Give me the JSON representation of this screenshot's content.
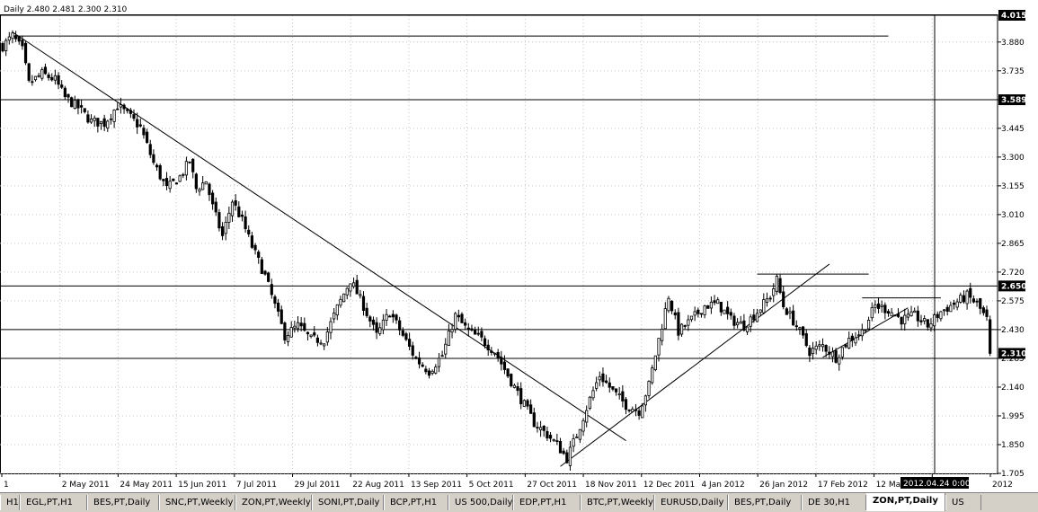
{
  "header": {
    "text": "Daily  2.480 2.481 2.300 2.310"
  },
  "tabs": [
    "H1",
    "EGL,PT,H1",
    "BES,PT,Daily",
    "SNC,PT,Weekly",
    "ZON,PT,Weekly",
    "SONI,PT,Daily",
    "BCP,PT,H1",
    "US 500,Daily",
    "EDP,PT,H1",
    "BTC,PT,Weekly",
    "EURUSD,Daily",
    "BES,PT,Daily",
    "DE 30,H1",
    "ZON,PT,Daily",
    "US"
  ],
  "active_tab_index": 13,
  "colors": {
    "background": "#ffffff",
    "candle": "#000000",
    "grid": "#c0c0c0",
    "label_bg": "#000000",
    "label_text": "#ffffff",
    "tab_bar": "#d4d0c8"
  },
  "crosshair": {
    "time_label": "2012.04.24 0:00",
    "price_label": "4.015"
  },
  "chart_data": {
    "type": "candlestick",
    "title": "",
    "symbol_ohlc": {
      "open": 2.48,
      "high": 2.481,
      "low": 2.3,
      "close": 2.31
    },
    "y_ticks": [
      3.88,
      3.735,
      3.589,
      3.445,
      3.3,
      3.155,
      3.01,
      2.865,
      2.72,
      2.575,
      2.43,
      2.285,
      2.14,
      1.995,
      1.85,
      1.705
    ],
    "ylim": [
      1.705,
      4.015
    ],
    "x_ticks": [
      "1",
      "2 May 2011",
      "24 May 2011",
      "15 Jun 2011",
      "7 Jul 2011",
      "29 Jul 2011",
      "22 Aug 2011",
      "13 Sep 2011",
      "5 Oct 2011",
      "27 Oct 2011",
      "18 Nov 2011",
      "12 Dec 2011",
      "4 Jan 2012",
      "26 Jan 2012",
      "17 Feb 2012",
      "12 Mar 2012",
      "3 A",
      "2012"
    ],
    "price_labels": [
      4.015,
      3.589,
      2.65,
      2.31
    ],
    "horizontal_levels": [
      4.015,
      3.589,
      2.65,
      2.43,
      2.285
    ],
    "close_path": [
      [
        0,
        3.86
      ],
      [
        3,
        3.91
      ],
      [
        6,
        3.84
      ],
      [
        8,
        3.67
      ],
      [
        12,
        3.72
      ],
      [
        16,
        3.69
      ],
      [
        19,
        3.6
      ],
      [
        23,
        3.55
      ],
      [
        27,
        3.48
      ],
      [
        31,
        3.47
      ],
      [
        35,
        3.56
      ],
      [
        39,
        3.5
      ],
      [
        42,
        3.45
      ],
      [
        46,
        3.27
      ],
      [
        50,
        3.14
      ],
      [
        54,
        3.2
      ],
      [
        57,
        3.28
      ],
      [
        59,
        3.14
      ],
      [
        62,
        3.18
      ],
      [
        64,
        3.05
      ],
      [
        67,
        2.9
      ],
      [
        70,
        3.08
      ],
      [
        73,
        2.98
      ],
      [
        76,
        2.85
      ],
      [
        80,
        2.7
      ],
      [
        83,
        2.55
      ],
      [
        86,
        2.4
      ],
      [
        90,
        2.45
      ],
      [
        94,
        2.38
      ],
      [
        98,
        2.38
      ],
      [
        102,
        2.54
      ],
      [
        106,
        2.68
      ],
      [
        110,
        2.55
      ],
      [
        114,
        2.4
      ],
      [
        118,
        2.52
      ],
      [
        122,
        2.4
      ],
      [
        126,
        2.28
      ],
      [
        130,
        2.22
      ],
      [
        134,
        2.3
      ],
      [
        138,
        2.5
      ],
      [
        142,
        2.42
      ],
      [
        146,
        2.38
      ],
      [
        150,
        2.32
      ],
      [
        154,
        2.2
      ],
      [
        158,
        2.08
      ],
      [
        162,
        1.96
      ],
      [
        166,
        1.9
      ],
      [
        169,
        1.85
      ],
      [
        172,
        1.78
      ],
      [
        175,
        1.9
      ],
      [
        179,
        2.08
      ],
      [
        182,
        2.2
      ],
      [
        186,
        2.12
      ],
      [
        190,
        2.05
      ],
      [
        194,
        2.02
      ],
      [
        197,
        2.15
      ],
      [
        200,
        2.38
      ],
      [
        203,
        2.6
      ],
      [
        206,
        2.42
      ],
      [
        210,
        2.48
      ],
      [
        214,
        2.55
      ],
      [
        218,
        2.56
      ],
      [
        222,
        2.48
      ],
      [
        226,
        2.45
      ],
      [
        230,
        2.52
      ],
      [
        234,
        2.6
      ],
      [
        236,
        2.68
      ],
      [
        238,
        2.55
      ],
      [
        242,
        2.45
      ],
      [
        246,
        2.32
      ],
      [
        250,
        2.35
      ],
      [
        254,
        2.29
      ],
      [
        258,
        2.38
      ],
      [
        262,
        2.42
      ],
      [
        266,
        2.55
      ],
      [
        270,
        2.53
      ],
      [
        274,
        2.48
      ],
      [
        278,
        2.5
      ],
      [
        282,
        2.45
      ],
      [
        286,
        2.52
      ],
      [
        290,
        2.56
      ],
      [
        294,
        2.6
      ],
      [
        297,
        2.56
      ],
      [
        300,
        2.48
      ],
      [
        301,
        2.31
      ]
    ],
    "trendlines": [
      {
        "x0": 3,
        "y0": 3.93,
        "x1": 190,
        "y1": 1.87
      },
      {
        "x0": 170,
        "y0": 1.74,
        "x1": 252,
        "y1": 2.76
      },
      {
        "x0": 3,
        "y0": 3.91,
        "x1": 270,
        "y1": 3.91
      },
      {
        "x0": 230,
        "y0": 2.71,
        "x1": 264,
        "y1": 2.71
      },
      {
        "x0": 250,
        "y0": 2.29,
        "x1": 276,
        "y1": 2.54
      },
      {
        "x0": 262,
        "y0": 2.59,
        "x1": 286,
        "y1": 2.59
      }
    ],
    "grid": true
  }
}
